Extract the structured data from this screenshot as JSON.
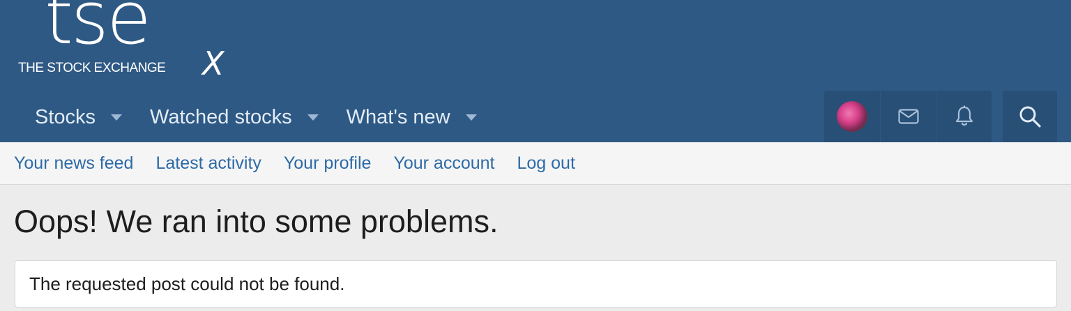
{
  "logo": {
    "main": "tse",
    "subtitle": "THE STOCK EXCHANGE",
    "mark": "X"
  },
  "nav": {
    "tabs": [
      {
        "label": "Stocks",
        "icon": "caret-down-icon"
      },
      {
        "label": "Watched stocks",
        "icon": "caret-down-icon"
      },
      {
        "label": "What's new",
        "icon": "caret-down-icon"
      }
    ]
  },
  "user_nav": {
    "items": [
      "avatar",
      "envelope-icon",
      "bell-icon"
    ],
    "search_icon": "search-icon"
  },
  "subnav": {
    "links": [
      "Your news feed",
      "Latest activity",
      "Your profile",
      "Your account",
      "Log out"
    ]
  },
  "page": {
    "title": "Oops! We ran into some problems.",
    "error": "The requested post could not be found."
  },
  "colors": {
    "header_bg": "#2e5984",
    "link": "#2e6aa6",
    "page_bg": "#ececec"
  }
}
